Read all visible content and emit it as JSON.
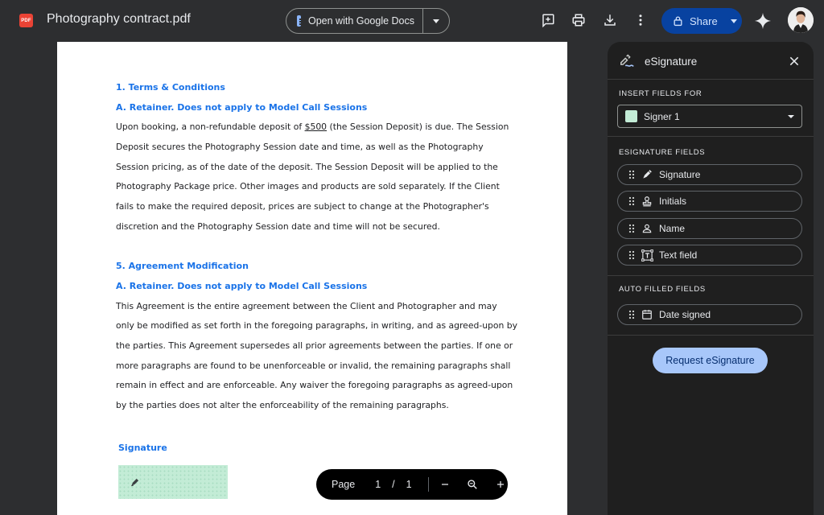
{
  "toolbar": {
    "file_badge": "PDF",
    "title": "Photography contract.pdf",
    "open_with_label": "Open with Google Docs",
    "share_label": "Share"
  },
  "document": {
    "section1_heading": "1. Terms & Conditions",
    "section1_subheading": "A. Retainer.  Does not apply to Model Call Sessions",
    "section1_lines": [
      [
        "Upon booking, a non-refundable deposit of ",
        "$500",
        " (the Session Deposit) is due. The Session"
      ],
      "Deposit secures the Photography Session date and time, as well as the Photography",
      "Session pricing, as of the date of the deposit. The Session Deposit will be applied to the",
      "Photography Package price. Other images and products are sold separately. If the Client",
      "fails to make the required deposit, prices are subject to change at the Photographer's",
      "discretion and the Photography Session date and time will not be secured."
    ],
    "section5_heading": "5. Agreement Modification",
    "section5_subheading": "A. Retainer.  Does not apply to Model Call Sessions",
    "section5_lines": [
      "This Agreement is the entire agreement between the Client and Photographer and may",
      "only be modified as set forth in the foregoing paragraphs, in writing, and as agreed-upon by",
      "the parties.  This Agreement supersedes all prior agreements between the parties. If one or",
      "more paragraphs are found to be unenforceable or invalid, the remaining paragraphs shall",
      "remain in effect and are enforceable. Any waiver the foregoing paragraphs as agreed-upon",
      "by the parties does not alter the enforceability of the remaining paragraphs."
    ],
    "signature_heading": "Signature"
  },
  "page_controls": {
    "label": "Page",
    "current": "1",
    "separator": "/",
    "total": "1"
  },
  "panel": {
    "title": "eSignature",
    "insert_fields_label": "INSERT FIELDS FOR",
    "signer": "Signer 1",
    "signer_color": "#c3ecd6",
    "esignature_fields_label": "ESIGNATURE FIELDS",
    "fields": [
      "Signature",
      "Initials",
      "Name",
      "Text field"
    ],
    "auto_filled_label": "AUTO FILLED FIELDS",
    "auto_fields": [
      "Date signed"
    ],
    "request_button": "Request eSignature"
  },
  "colors": {
    "background": "#2d2e30",
    "panel": "#1f1f1f",
    "accent_blue": "#1a73e8",
    "share_button": "#0842a0",
    "request_button": "#a8c7fa"
  }
}
